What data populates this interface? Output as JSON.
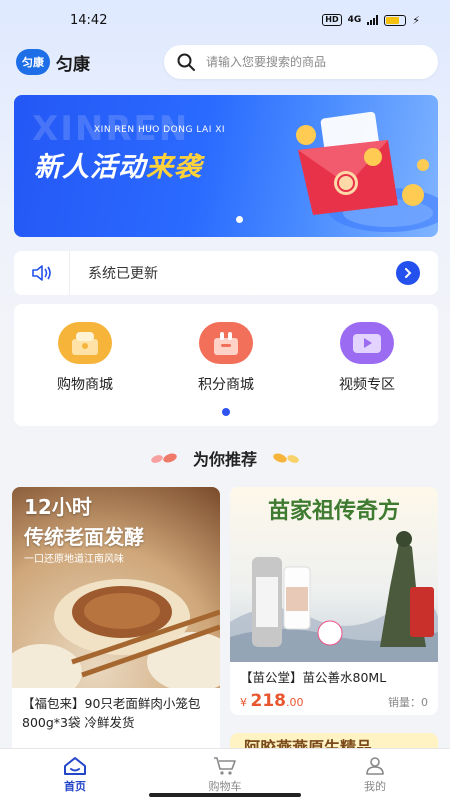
{
  "status_bar": {
    "time": "14:42",
    "hd": "HD",
    "network": "4G"
  },
  "header": {
    "logo_mark": "匀康",
    "app_name": "匀康",
    "search_placeholder": "请输入您要搜索的商品"
  },
  "banner": {
    "ghost_text": "XINREN",
    "subtitle": "XIN REN HUO DONG LAI XI",
    "title_main": "新人活动",
    "title_highlight": "来袭",
    "accent": "#ffd23a"
  },
  "notice": {
    "text": "系统已更新"
  },
  "categories": [
    {
      "label": "购物商城",
      "icon": "shopping-mall-icon",
      "color": "#f7b43a"
    },
    {
      "label": "积分商城",
      "icon": "points-mall-icon",
      "color": "#f26f59"
    },
    {
      "label": "视频专区",
      "icon": "video-zone-icon",
      "color": "#9b6cf2"
    }
  ],
  "recommend": {
    "title": "为你推荐"
  },
  "products": [
    {
      "img_line1": "12小时",
      "img_line2": "传统老面发酵",
      "img_line3": "一口还原地道江南风味",
      "name": "【福包来】90只老面鲜肉小笼包800g*3袋 冷鲜发货",
      "price_symbol": "¥",
      "price_int": "",
      "price_dec": "",
      "sales": ""
    },
    {
      "img_title": "苗家祖传奇方",
      "name": "【苗公堂】苗公善水80ML",
      "price_symbol": "¥",
      "price_int": "218",
      "price_dec": ".00",
      "sales": "销量：0"
    }
  ],
  "peek_card": {
    "title": "阿胶燕燕原生精品"
  },
  "tabbar": [
    {
      "label": "首页",
      "icon": "home-icon",
      "active": true
    },
    {
      "label": "购物车",
      "icon": "cart-icon",
      "active": false
    },
    {
      "label": "我的",
      "icon": "profile-icon",
      "active": false
    }
  ],
  "colors": {
    "primary": "#2451ee",
    "price": "#e8562f",
    "active_tab": "#2447c9"
  }
}
